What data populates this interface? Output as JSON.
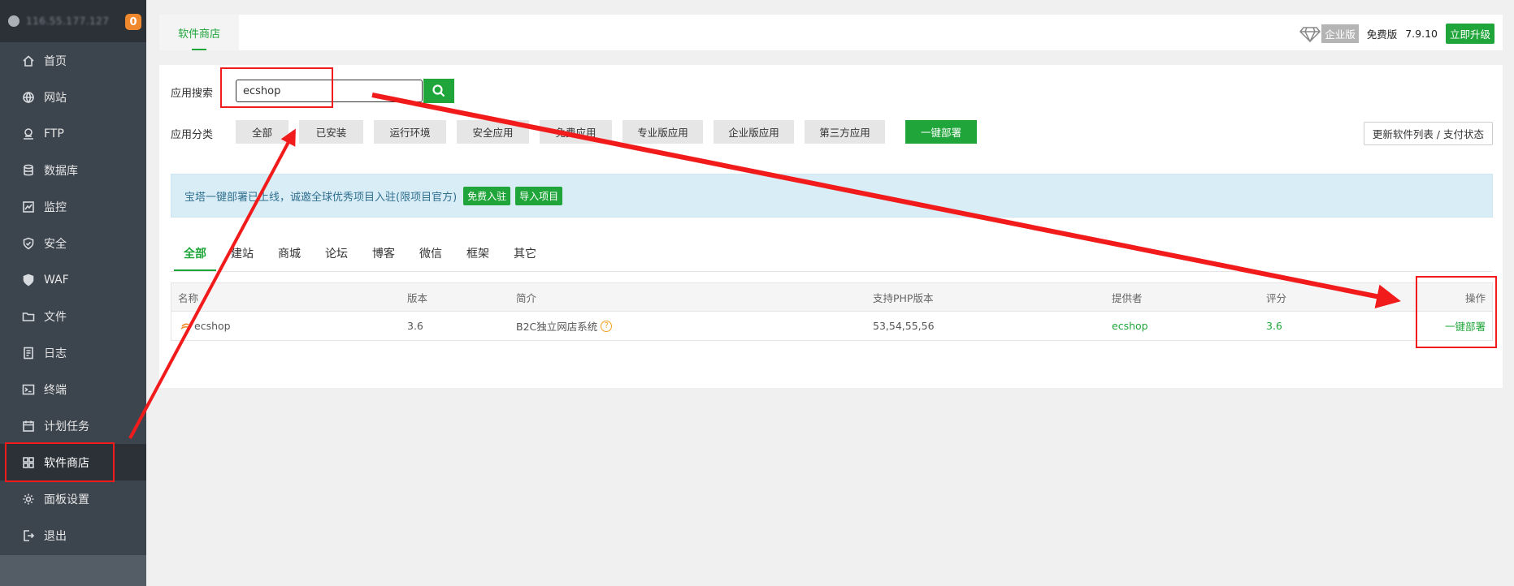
{
  "sidebar": {
    "user": "116.55.177.127",
    "badge": "0",
    "items": [
      {
        "label": "首页"
      },
      {
        "label": "网站"
      },
      {
        "label": "FTP"
      },
      {
        "label": "数据库"
      },
      {
        "label": "监控"
      },
      {
        "label": "安全"
      },
      {
        "label": "WAF"
      },
      {
        "label": "文件"
      },
      {
        "label": "日志"
      },
      {
        "label": "终端"
      },
      {
        "label": "计划任务"
      },
      {
        "label": "软件商店"
      },
      {
        "label": "面板设置"
      },
      {
        "label": "退出"
      }
    ],
    "active_index": 11
  },
  "header": {
    "tab_label": "软件商店",
    "enterprise_label": "企业版",
    "free_label": "免费版",
    "version": "7.9.10",
    "upgrade_label": "立即升级"
  },
  "search": {
    "label": "应用搜索",
    "value": "ecshop",
    "button_icon": "search-icon"
  },
  "categories": {
    "label": "应用分类",
    "items": [
      "全部",
      "已安装",
      "运行环境",
      "安全应用",
      "免费应用",
      "专业版应用",
      "企业版应用",
      "第三方应用",
      "一键部署"
    ],
    "active": "一键部署",
    "refresh_label": "更新软件列表 / 支付状态"
  },
  "banner": {
    "text": "宝塔一键部署已上线，诚邀全球优秀项目入驻(限项目官方)",
    "btn_join": "免费入驻",
    "btn_import": "导入项目"
  },
  "subtabs": {
    "items": [
      "全部",
      "建站",
      "商城",
      "论坛",
      "博客",
      "微信",
      "框架",
      "其它"
    ],
    "active": "全部"
  },
  "table": {
    "headers": [
      "名称",
      "版本",
      "简介",
      "支持PHP版本",
      "提供者",
      "评分",
      "操作"
    ],
    "rows": [
      {
        "name": "ecshop",
        "version": "3.6",
        "intro": "B2C独立网店系统",
        "php": "53,54,55,56",
        "provider": "ecshop",
        "score": "3.6",
        "action": "一键部署"
      }
    ]
  },
  "colors": {
    "accent": "#20a53a",
    "sidebar_bg": "#3c444d",
    "annotation": "#f21b1b"
  }
}
